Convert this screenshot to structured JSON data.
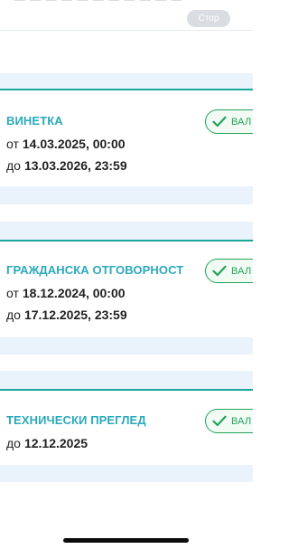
{
  "header": {
    "cut_text": "— — — — — — — — — — —",
    "chip_label": "Стор"
  },
  "cards": [
    {
      "title": "ВИНЕТКА",
      "status": "ВАЛ",
      "lines": [
        {
          "prefix": "от",
          "value": "14.03.2025, 00:00"
        },
        {
          "prefix": "до",
          "value": "13.03.2026, 23:59"
        }
      ]
    },
    {
      "title": "ГРАЖДАНСКА ОТГОВОРНОСТ",
      "status": "ВАЛ",
      "lines": [
        {
          "prefix": "от",
          "value": "18.12.2024, 00:00"
        },
        {
          "prefix": "до",
          "value": "17.12.2025, 23:59"
        }
      ]
    },
    {
      "title": "ТЕХНИЧЕСКИ ПРЕГЛЕД",
      "status": "ВАЛ",
      "lines": [
        {
          "prefix": "до",
          "value": "12.12.2025"
        }
      ]
    }
  ],
  "colors": {
    "accent_title": "#2aa9bc",
    "card_border": "#1aa79a",
    "status_green": "#23a35a",
    "band": "#eaf2fb"
  },
  "icons": {
    "status": "checkmark-icon"
  }
}
